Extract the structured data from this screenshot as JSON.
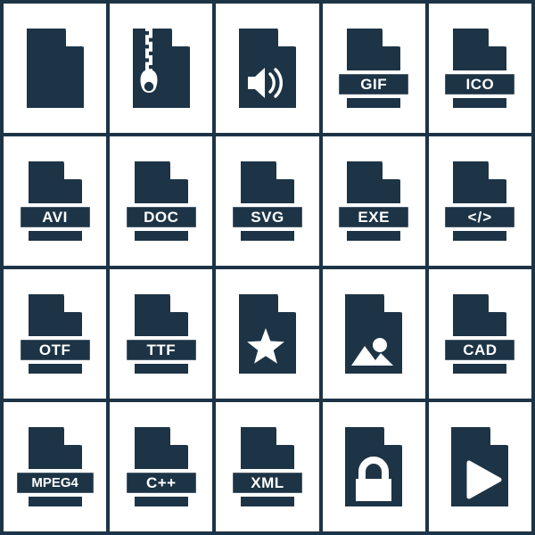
{
  "palette": {
    "icon_fill": "#1d3446",
    "grid_line": "#1d3446",
    "cell_background": "#ffffff",
    "label_text": "#ffffff",
    "icon_outline": "#ffffff"
  },
  "grid": {
    "columns": 5,
    "rows": 4,
    "total_icons": 20
  },
  "icons": [
    {
      "id": "file-blank",
      "label": "",
      "glyph": "plain-document",
      "row": 1,
      "col": 1
    },
    {
      "id": "file-zip",
      "label": "",
      "glyph": "zipper",
      "row": 1,
      "col": 2
    },
    {
      "id": "file-audio",
      "label": "",
      "glyph": "speaker",
      "row": 1,
      "col": 3
    },
    {
      "id": "file-gif",
      "label": "GIF",
      "glyph": "label-band",
      "row": 1,
      "col": 4
    },
    {
      "id": "file-ico",
      "label": "ICO",
      "glyph": "label-band",
      "row": 1,
      "col": 5
    },
    {
      "id": "file-avi",
      "label": "AVI",
      "glyph": "label-band",
      "row": 2,
      "col": 1
    },
    {
      "id": "file-doc",
      "label": "DOC",
      "glyph": "label-band",
      "row": 2,
      "col": 2
    },
    {
      "id": "file-svg",
      "label": "SVG",
      "glyph": "label-band",
      "row": 2,
      "col": 3
    },
    {
      "id": "file-exe",
      "label": "EXE",
      "glyph": "label-band",
      "row": 2,
      "col": 4
    },
    {
      "id": "file-code",
      "label": "</>",
      "glyph": "label-band",
      "row": 2,
      "col": 5
    },
    {
      "id": "file-otf",
      "label": "OTF",
      "glyph": "label-band",
      "row": 3,
      "col": 1
    },
    {
      "id": "file-ttf",
      "label": "TTF",
      "glyph": "label-band",
      "row": 3,
      "col": 2
    },
    {
      "id": "file-star",
      "label": "",
      "glyph": "star",
      "row": 3,
      "col": 3
    },
    {
      "id": "file-image",
      "label": "",
      "glyph": "picture",
      "row": 3,
      "col": 4
    },
    {
      "id": "file-cad",
      "label": "CAD",
      "glyph": "label-band",
      "row": 3,
      "col": 5
    },
    {
      "id": "file-mpeg4",
      "label": "MPEG4",
      "glyph": "label-band-wide",
      "row": 4,
      "col": 1
    },
    {
      "id": "file-cpp",
      "label": "C++",
      "glyph": "label-band",
      "row": 4,
      "col": 2
    },
    {
      "id": "file-xml",
      "label": "XML",
      "glyph": "label-band",
      "row": 4,
      "col": 3
    },
    {
      "id": "file-lock",
      "label": "",
      "glyph": "padlock",
      "row": 4,
      "col": 4
    },
    {
      "id": "file-play",
      "label": "",
      "glyph": "play-triangle",
      "row": 4,
      "col": 5
    }
  ]
}
